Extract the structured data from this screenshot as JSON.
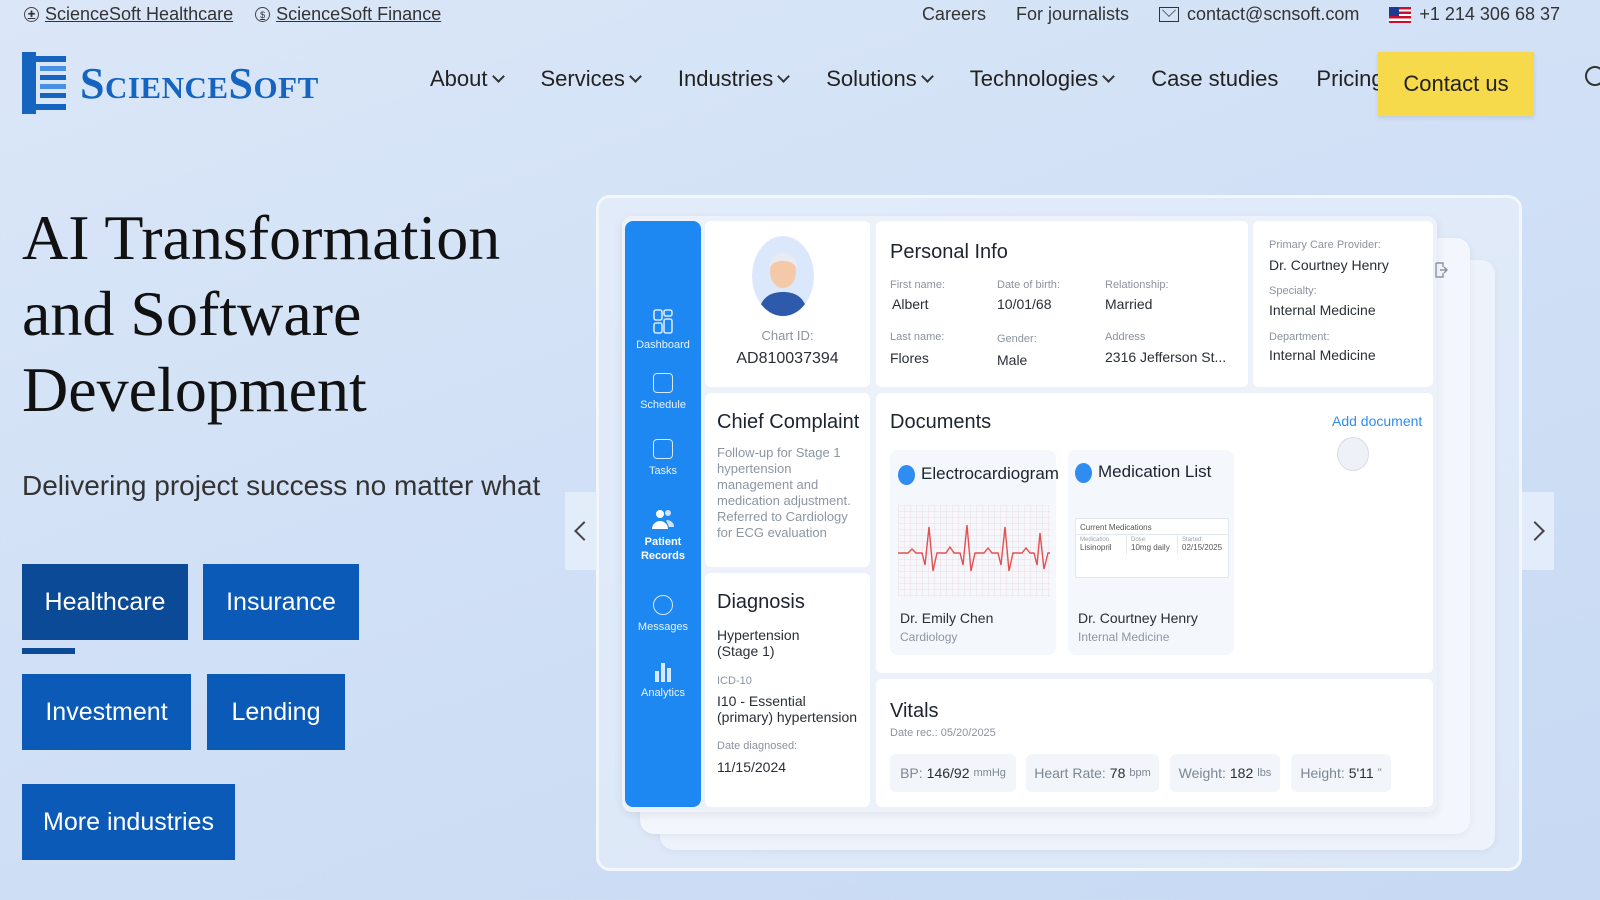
{
  "topbar": {
    "links": [
      "ScienceSoft Healthcare",
      "ScienceSoft Finance"
    ],
    "careers": "Careers",
    "journalists": "For journalists",
    "email": "contact@scnsoft.com",
    "phone": "+1 214 306 68 37"
  },
  "brand": {
    "name": "ScienceSoft"
  },
  "nav": {
    "items": [
      {
        "label": "About",
        "dropdown": true
      },
      {
        "label": "Services",
        "dropdown": true
      },
      {
        "label": "Industries",
        "dropdown": true
      },
      {
        "label": "Solutions",
        "dropdown": true
      },
      {
        "label": "Technologies",
        "dropdown": true
      },
      {
        "label": "Case studies",
        "dropdown": false
      },
      {
        "label": "Pricing",
        "dropdown": false
      }
    ],
    "contact": "Contact us"
  },
  "hero": {
    "title": "AI Transformation and Software Development",
    "subtitle": "Delivering project success no matter what",
    "industries": [
      "Healthcare",
      "Insurance",
      "Investment",
      "Lending",
      "More industries"
    ],
    "active_industry": "Healthcare"
  },
  "dashboard": {
    "sidebar": [
      "Dashboard",
      "Schedule",
      "Tasks",
      "Patient Records",
      "Messages",
      "Analytics"
    ],
    "chart_id_label": "Chart ID:",
    "chart_id": "AD810037394",
    "personal_info": {
      "title": "Personal Info",
      "first_name_label": "First name:",
      "first_name": "Albert",
      "dob_label": "Date of birth:",
      "dob": "10/01/68",
      "relationship_label": "Relationship:",
      "relationship": "Married",
      "last_name_label": "Last name:",
      "last_name": "Flores",
      "gender_label": "Gender:",
      "gender": "Male",
      "address_label": "Address",
      "address": "2316 Jefferson St..."
    },
    "provider": {
      "pcp_label": "Primary Care Provider:",
      "pcp": "Dr. Courtney Henry",
      "specialty_label": "Specialty:",
      "specialty": "Internal Medicine",
      "department_label": "Department:",
      "department": "Internal Medicine"
    },
    "chief_complaint": {
      "title": "Chief Complaint",
      "text": "Follow-up for Stage 1 hypertension management and medication adjustment. Referred to Cardiology for ECG evaluation"
    },
    "documents": {
      "title": "Documents",
      "add": "Add document",
      "items": [
        {
          "title": "Electrocardiogram",
          "doctor": "Dr. Emily Chen",
          "dept": "Cardiology"
        },
        {
          "title": "Medication List",
          "doctor": "Dr. Courtney Henry",
          "dept": "Internal Medicine"
        }
      ],
      "med_table": {
        "heading": "Current Medications",
        "cols": [
          "Medication",
          "Dose:",
          "Started:"
        ],
        "row": [
          "Lisinopril",
          "10mg daily",
          "02/15/2025"
        ]
      }
    },
    "diagnosis": {
      "title": "Diagnosis",
      "name": "Hypertension (Stage 1)",
      "icd_label": "ICD-10",
      "icd": "I10 - Essential (primary) hypertension",
      "date_label": "Date diagnosed:",
      "date": "11/15/2024"
    },
    "vitals": {
      "title": "Vitals",
      "date": "Date rec.: 05/20/2025",
      "bp_label": "BP:",
      "bp": "146/92",
      "bp_unit": "mmHg",
      "hr_label": "Heart Rate:",
      "hr": "78",
      "hr_unit": "bpm",
      "w_label": "Weight:",
      "w": "182",
      "w_unit": "lbs",
      "h_label": "Height:",
      "h": "5'11",
      "h_unit": "\""
    }
  },
  "colors": {
    "primary": "#0b5ab8",
    "accent": "#f7d94c",
    "sidebar": "#1e88f2"
  }
}
